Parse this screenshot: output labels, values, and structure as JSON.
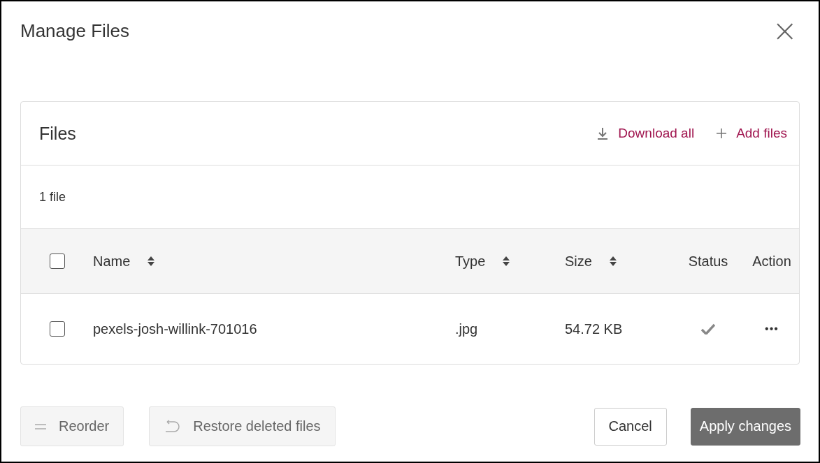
{
  "dialog": {
    "title": "Manage Files",
    "close": "×"
  },
  "panel": {
    "title": "Files",
    "actions": [
      {
        "kind": "download",
        "label": "Download all"
      },
      {
        "kind": "add",
        "label": "Add files"
      }
    ],
    "count": "1 file",
    "table": {
      "select_all": {
        "checked": false
      },
      "columns": [
        {
          "label": "Name",
          "sortable": true
        },
        {
          "label": "Type",
          "sortable": true
        },
        {
          "label": "Size",
          "sortable": true
        },
        {
          "label": "Status",
          "sortable": false
        },
        {
          "label": "Action",
          "sortable": false
        }
      ],
      "rows": [
        {
          "checked": false,
          "name": "pexels-josh-willink-701016",
          "type": ".jpg",
          "size": "54.72 KB",
          "complete": true,
          "action": "•••"
        }
      ]
    }
  },
  "footer": {
    "left": [
      {
        "kind": "reorder",
        "label": "Reorder",
        "disabled": true
      },
      {
        "kind": "restore",
        "label": "Restore deleted files",
        "disabled": true
      }
    ],
    "right": [
      {
        "kind": "secondary",
        "label": "Cancel"
      },
      {
        "kind": "primary",
        "label": "Apply changes"
      }
    ]
  }
}
